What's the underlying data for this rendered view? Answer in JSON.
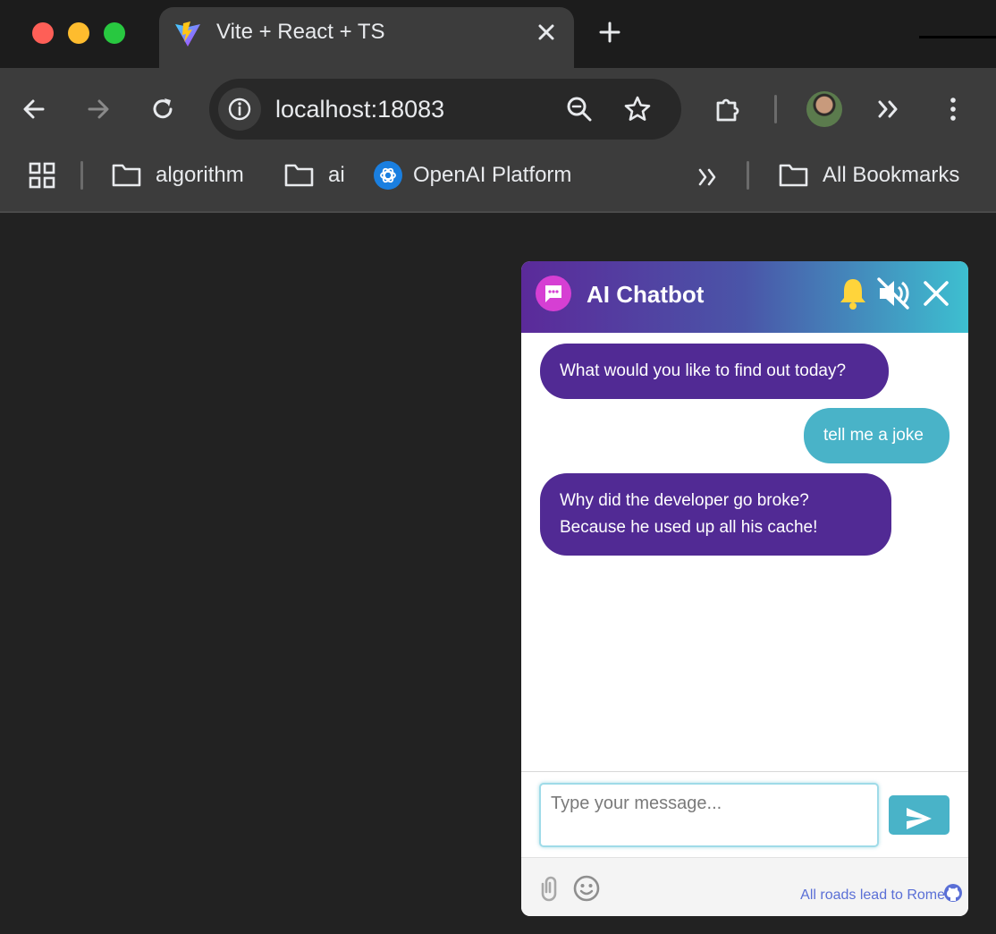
{
  "browser": {
    "tab_title": "Vite + React + TS",
    "url": "localhost:18083",
    "bookmarks": [
      {
        "label": "algorithm",
        "icon": "folder-icon"
      },
      {
        "label": "ai",
        "icon": "folder-icon"
      },
      {
        "label": "OpenAI Platform",
        "icon": "openai-icon"
      },
      {
        "label": "All Bookmarks",
        "icon": "folder-icon"
      }
    ]
  },
  "chat": {
    "title": "AI Chatbot",
    "messages": [
      {
        "role": "bot",
        "text": "What would you like to find out today?"
      },
      {
        "role": "user",
        "text": "tell me a joke"
      },
      {
        "role": "bot",
        "text": "Why did the developer go broke?\nBecause he used up all his cache!"
      }
    ],
    "input_placeholder": "Type your message...",
    "input_value": "",
    "footer_link": "All roads lead to Rome",
    "colors": {
      "bot_bubble": "#512a94",
      "user_bubble": "#49b3c8",
      "header_gradient_start": "#5b2a9a",
      "header_gradient_end": "#3dbfd0",
      "bell": "#ffd43b"
    }
  }
}
